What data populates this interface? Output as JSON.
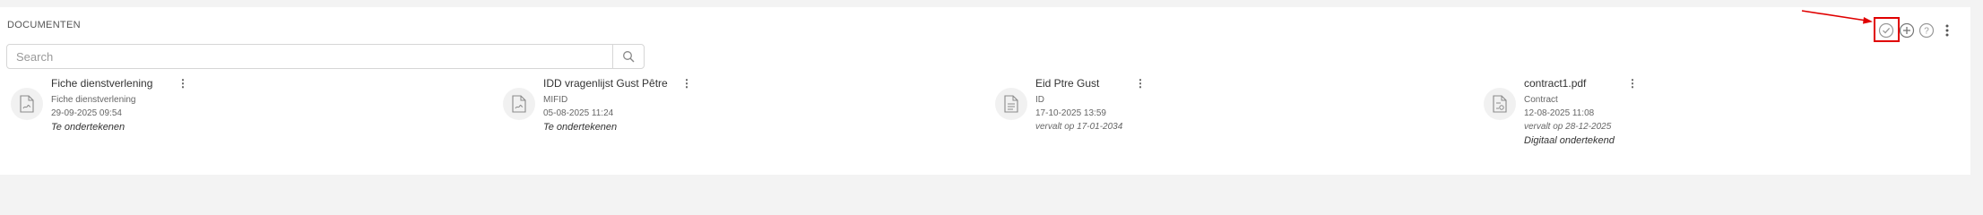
{
  "section": {
    "title": "DOCUMENTEN"
  },
  "search": {
    "placeholder": "Search",
    "value": ""
  },
  "toolbar": {
    "buttons": [
      {
        "icon": "check-circle-icon"
      },
      {
        "icon": "plus-circle-icon"
      },
      {
        "icon": "help-circle-icon"
      },
      {
        "icon": "more-vertical-icon"
      }
    ],
    "highlight_color": "#e00000"
  },
  "documents": [
    {
      "title": "Fiche dienstverlening",
      "type": "Fiche dienstverlening",
      "date": "29-09-2025 09:54",
      "status": "Te ondertekenen"
    },
    {
      "title": "IDD vragenlijst Gust Pêtre",
      "type": "MIFID",
      "date": "05-08-2025 11:24",
      "status": "Te ondertekenen"
    },
    {
      "title": "Eid Ptre Gust",
      "type": "ID",
      "date": "17-10-2025 13:59",
      "expiry": "vervalt op 17-01-2034"
    },
    {
      "title": "contract1.pdf",
      "type": "Contract",
      "date": "12-08-2025 11:08",
      "expiry": "vervalt op 28-12-2025",
      "status": "Digitaal ondertekend"
    }
  ]
}
